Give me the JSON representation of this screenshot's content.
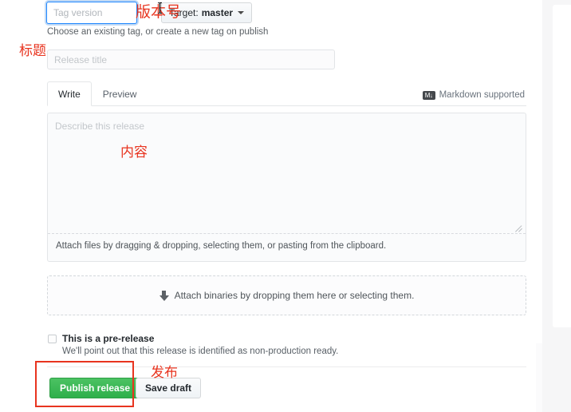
{
  "form": {
    "tag": {
      "placeholder": "Tag version",
      "value": "",
      "help_text": "Choose an existing tag, or create a new tag on publish"
    },
    "target": {
      "prefix_label": "Target:",
      "branch": "master",
      "caret_icon": "chevron-down-icon"
    },
    "title": {
      "placeholder": "Release title",
      "value": ""
    },
    "editor": {
      "tabs": [
        {
          "label": "Write",
          "active": true
        },
        {
          "label": "Preview",
          "active": false
        }
      ],
      "markdown_note": "Markdown supported",
      "markdown_icon_text": "M↓",
      "body_placeholder": "Describe this release",
      "body_value": "",
      "attach_footer": "Attach files by dragging & dropping, selecting them, or pasting from the clipboard."
    },
    "binaries": {
      "label": "Attach binaries by dropping them here or selecting them.",
      "icon": "arrow-down-icon"
    },
    "prerelease": {
      "checked": false,
      "label": "This is a pre-release",
      "description": "We'll point out that this release is identified as non-production ready."
    },
    "actions": {
      "publish_label": "Publish release",
      "draft_label": "Save draft"
    }
  },
  "annotations": {
    "version": "版本号",
    "title": "标题",
    "content": "内容",
    "publish": "发布"
  },
  "colors": {
    "annotation_red": "#e8341f",
    "publish_green": "#2eaf4b",
    "focus_blue": "#2188ff"
  }
}
